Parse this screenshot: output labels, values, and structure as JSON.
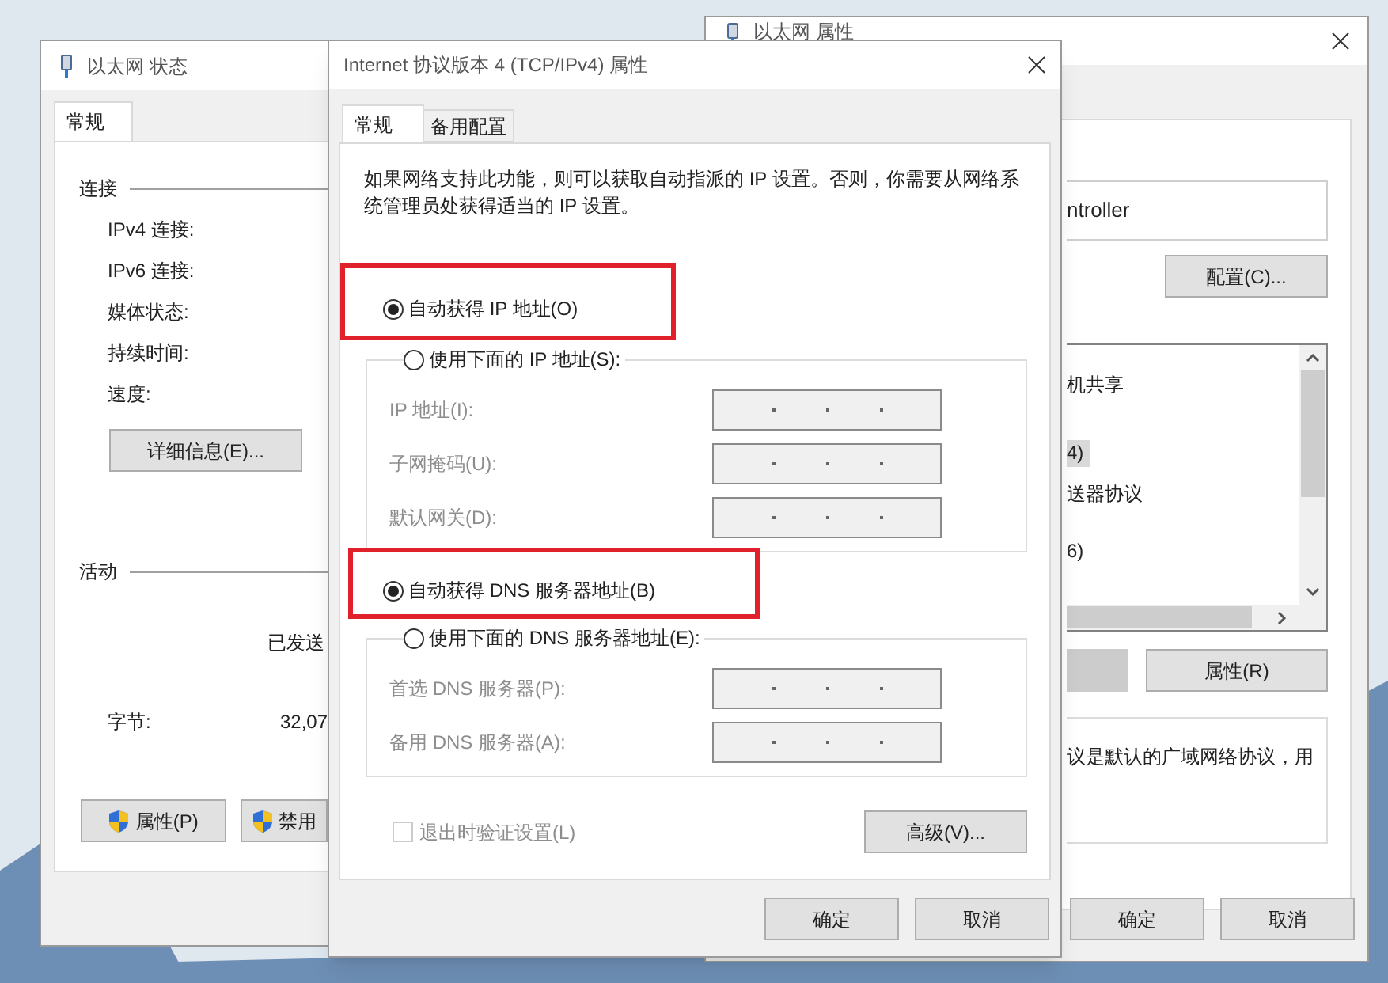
{
  "status_window": {
    "title": "以太网 状态",
    "tabs": [
      {
        "label": "常规",
        "selected": true
      }
    ],
    "connection": {
      "heading": "连接",
      "rows": [
        "IPv4 连接:",
        "IPv6 连接:",
        "媒体状态:",
        "持续时间:",
        "速度:"
      ],
      "details_button": "详细信息(E)..."
    },
    "activity": {
      "heading": "活动",
      "sent_label": "已发送",
      "bytes_label": "字节:",
      "bytes_sent": "32,07"
    },
    "buttons": [
      "属性(P)",
      "禁用"
    ]
  },
  "properties_window": {
    "title": "以太网 属性",
    "adapter_name": "ntroller",
    "configure_button": "配置(C)...",
    "items": [
      {
        "label": "机共享",
        "selected": false
      },
      {
        "label": "4)",
        "selected": true
      },
      {
        "label": "送器协议",
        "selected": false
      },
      {
        "label": "6)",
        "selected": false
      }
    ],
    "properties_button": "属性(R)",
    "description": "议是默认的广域网络协议，用",
    "buttons": [
      "确定",
      "取消"
    ]
  },
  "ipv4_dialog": {
    "title": "Internet 协议版本 4 (TCP/IPv4) 属性",
    "tabs": [
      {
        "label": "常规",
        "selected": true
      },
      {
        "label": "备用配置",
        "selected": false
      }
    ],
    "description": "如果网络支持此功能，则可以获取自动指派的 IP 设置。否则，你需要从网络系统管理员处获得适当的 IP 设置。",
    "ip_auto": {
      "label": "自动获得 IP 地址(O)",
      "selected": true
    },
    "ip_manual": {
      "label": "使用下面的 IP 地址(S):",
      "selected": false,
      "fields": [
        "IP 地址(I):",
        "子网掩码(U):",
        "默认网关(D):"
      ]
    },
    "dns_auto": {
      "label": "自动获得 DNS 服务器地址(B)",
      "selected": true
    },
    "dns_manual": {
      "label": "使用下面的 DNS 服务器地址(E):",
      "selected": false,
      "fields": [
        "首选 DNS 服务器(P):",
        "备用 DNS 服务器(A):"
      ]
    },
    "validate": {
      "label": "退出时验证设置(L)",
      "checked": false,
      "disabled": true
    },
    "advanced_button": "高级(V)...",
    "buttons": [
      "确定",
      "取消"
    ]
  }
}
